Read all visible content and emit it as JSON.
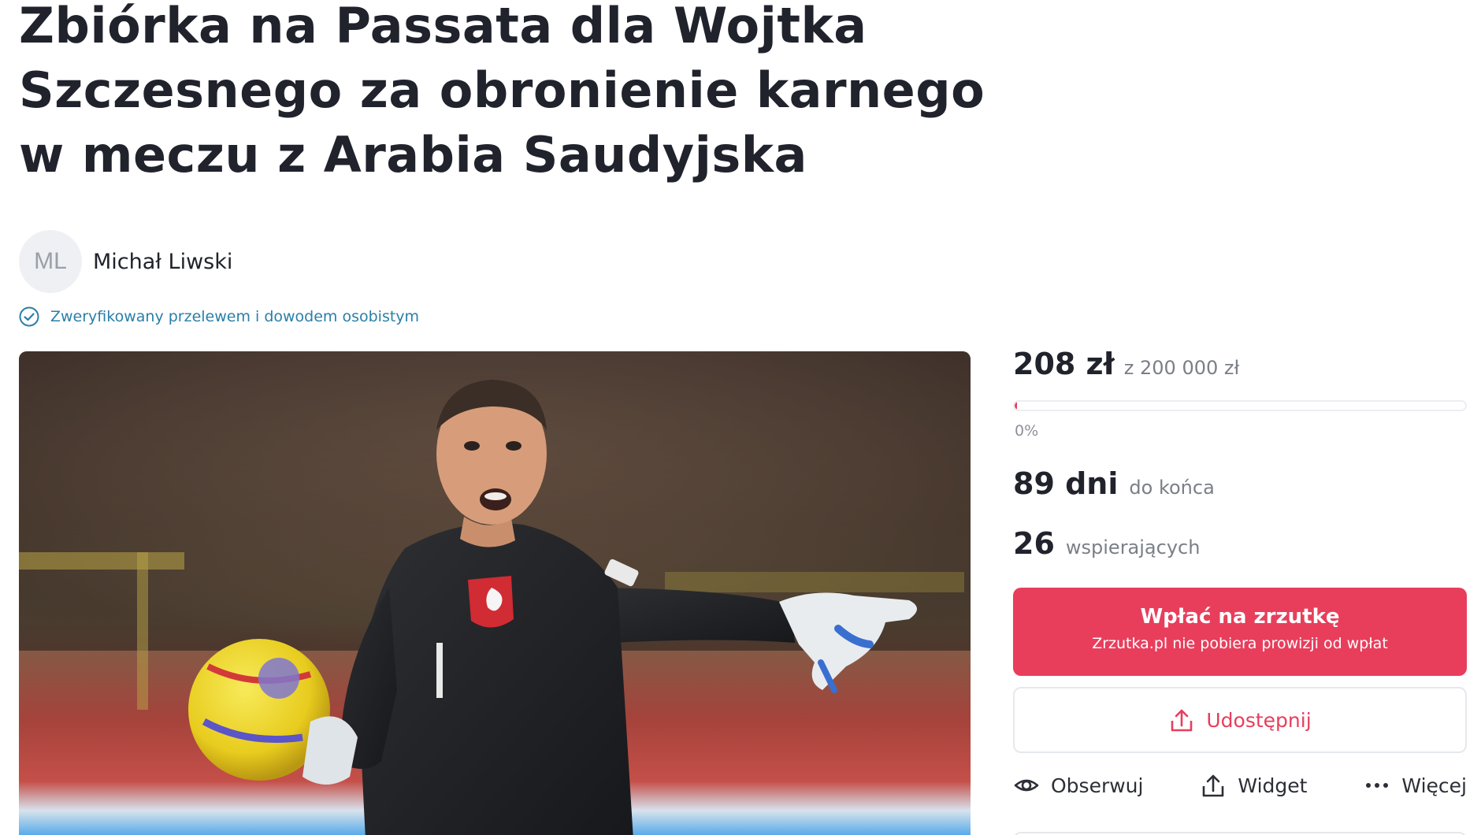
{
  "campaign": {
    "title": "Zbiórka na Passata dla Wojtka Szczesnego za obronienie karnego w meczu z Arabia Saudyjska"
  },
  "author": {
    "initials": "ML",
    "name": "Michał Liwski",
    "verified_text": "Zweryfikowany przelewem i dowodem osobistym"
  },
  "funding": {
    "raised": "208 zł",
    "goal": "z 200 000 zł",
    "progress_label": "0%",
    "progress_fraction": 0.003,
    "days_left": "89 dni",
    "days_label": "do końca",
    "supporters": "26",
    "supporters_label": "wspierających"
  },
  "buttons": {
    "pay_label": "Wpłać na zrzutkę",
    "pay_sublabel": "Zrzutka.pl nie pobiera prowizji od wpłat",
    "share_label": "Udostępnij",
    "follow_label": "Obserwuj",
    "widget_label": "Widget",
    "more_label": "Więcej"
  },
  "icons": {
    "verified": "check-circle-icon",
    "share": "share-icon",
    "follow": "eye-icon",
    "widget": "upload-icon",
    "more": "ellipsis-icon"
  },
  "colors": {
    "accent": "#e83e5c",
    "verified": "#2a7fa8",
    "text": "#20222c",
    "muted": "#7a7f87"
  }
}
